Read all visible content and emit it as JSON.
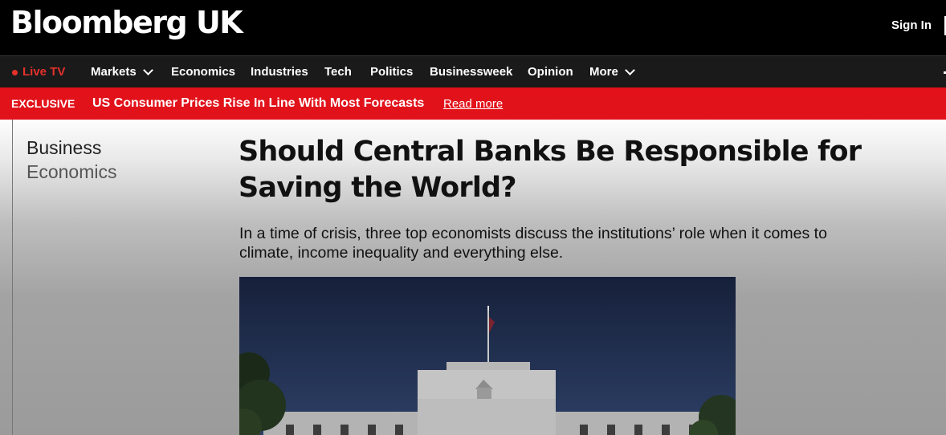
{
  "header": {
    "logo": "Bloomberg UK",
    "sign_in": "Sign In"
  },
  "nav": {
    "live_tv": "Live TV",
    "items": [
      "Markets",
      "Economics",
      "Industries",
      "Tech",
      "Politics",
      "Businessweek",
      "Opinion",
      "More"
    ]
  },
  "banner": {
    "tag": "EXCLUSIVE",
    "headline": "US Consumer Prices Rise In Line With Most Forecasts",
    "link": "Read more"
  },
  "article": {
    "category": "Business",
    "subcategory": "Economics",
    "title": "Should Central Banks Be Responsible for Saving the World?",
    "subtitle": "In a time of crisis, three top economists discuss the institutions’ role when it comes to climate, income inequality and everything else."
  },
  "colors": {
    "accent_red": "#e2121b",
    "live_red": "#e5312b",
    "nav_bg": "#1a1a1a"
  }
}
